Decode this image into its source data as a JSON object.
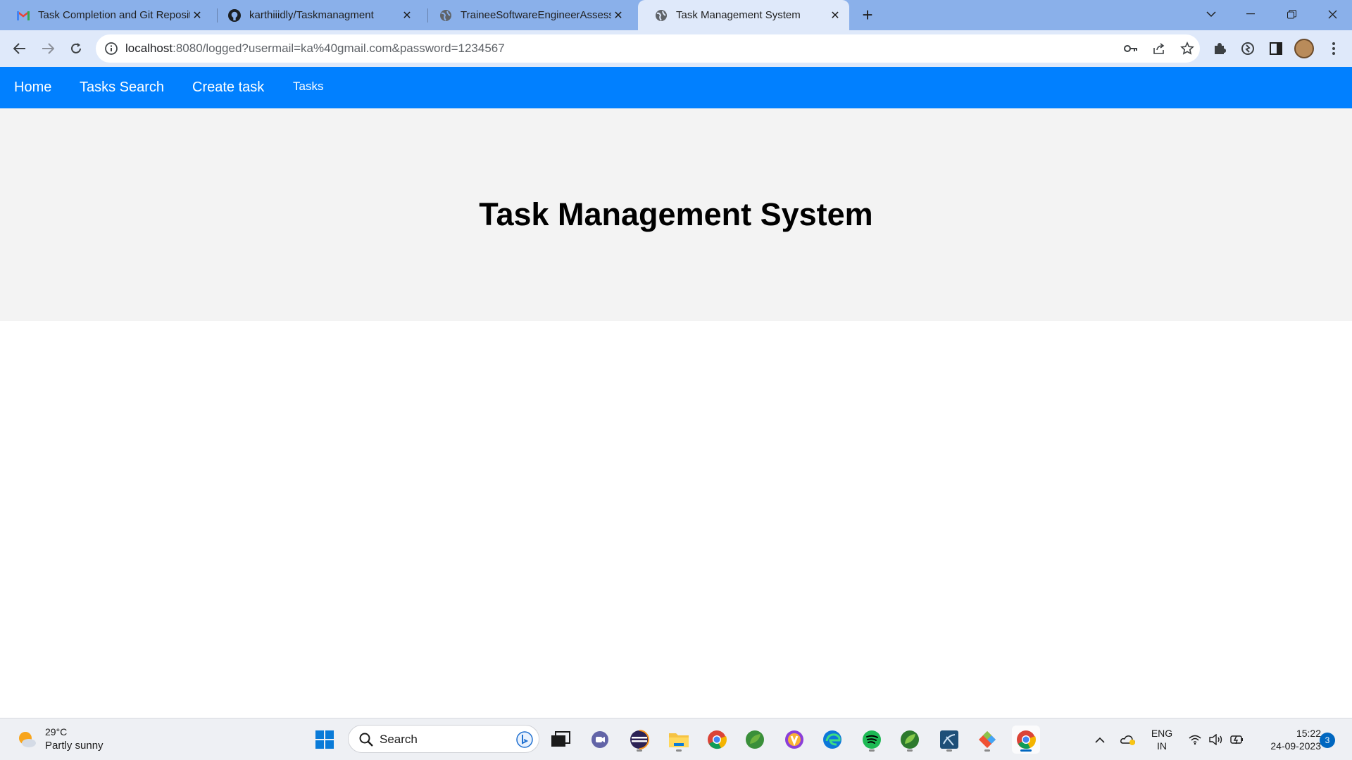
{
  "browser": {
    "tabs": [
      {
        "title": "Task Completion and Git Reposit",
        "icon": "gmail-icon",
        "active": false
      },
      {
        "title": "karthiiidly/Taskmanagment",
        "icon": "github-icon",
        "active": false
      },
      {
        "title": "TraineeSoftwareEngineerAssessm",
        "icon": "globe-icon",
        "active": false
      },
      {
        "title": "Task Management System",
        "icon": "globe-icon",
        "active": true
      }
    ],
    "url": {
      "host": "localhost",
      "rest": ":8080/logged?usermail=ka%40gmail.com&password=1234567"
    }
  },
  "page": {
    "nav": {
      "home": "Home",
      "tasks_search": "Tasks Search",
      "create_task": "Create task",
      "tasks": "Tasks"
    },
    "heading": "Task Management System"
  },
  "taskbar": {
    "weather_temp": "29°C",
    "weather_condition": "Partly sunny",
    "search_label": "Search",
    "language_line1": "ENG",
    "language_line2": "IN",
    "time": "15:22",
    "date": "24-09-2023",
    "notification_count": "3"
  },
  "colors": {
    "navbar": "#0180ff",
    "hero_bg": "#f3f3f3",
    "tabstrip": "#8ab0ea",
    "toolbar": "#dfe9fa"
  }
}
